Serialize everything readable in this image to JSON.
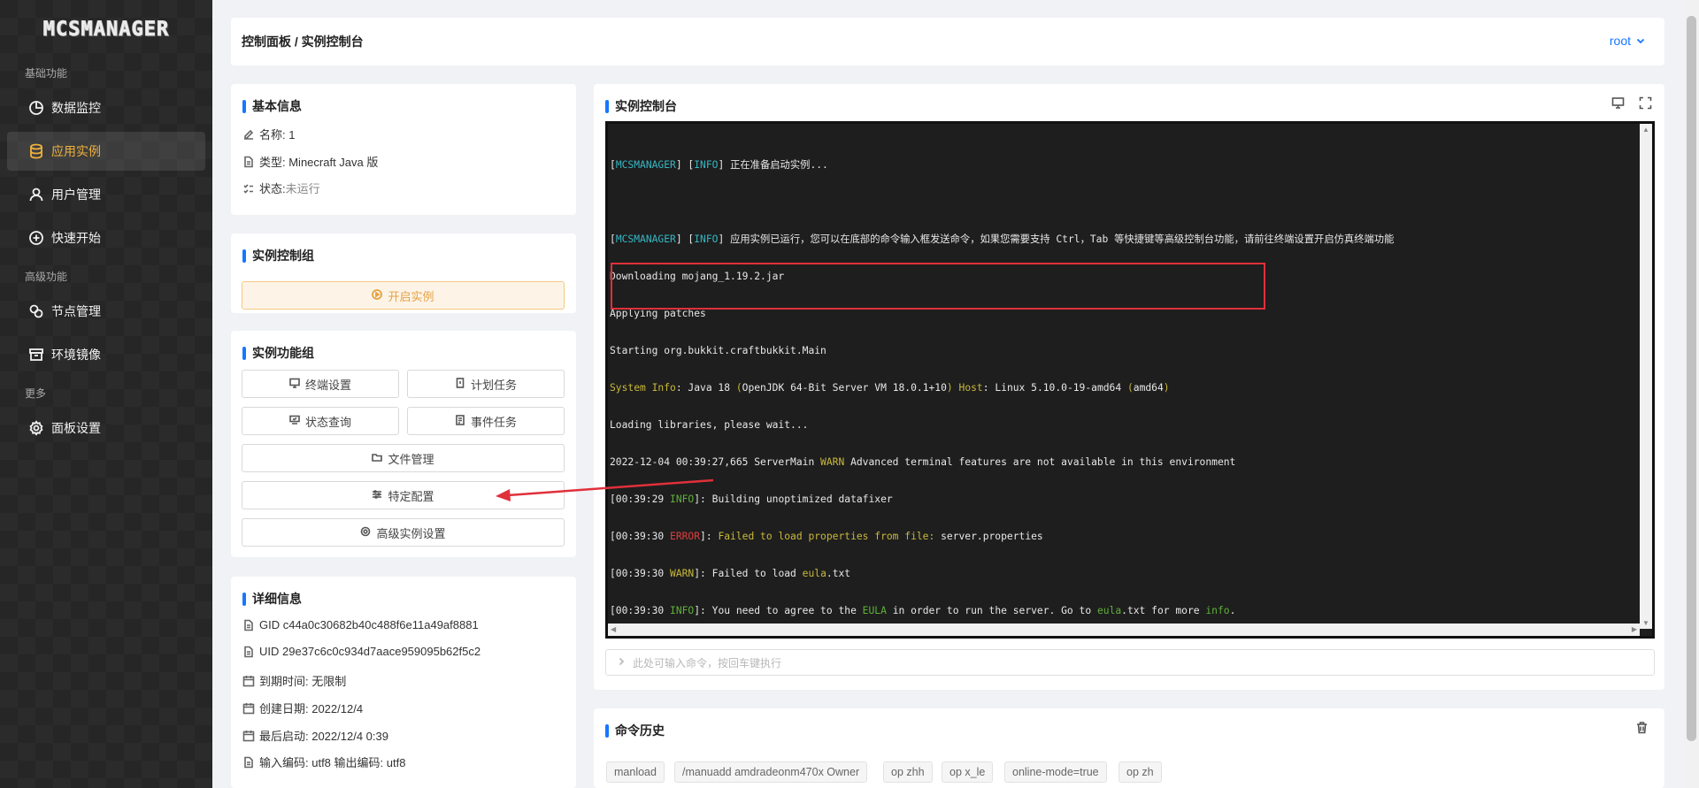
{
  "app": {
    "logo_text": "MCSMANAGER"
  },
  "sidebar": {
    "groups": [
      {
        "title": "基础功能"
      },
      {
        "title": "高级功能"
      },
      {
        "title": "更多"
      }
    ],
    "items": [
      {
        "label": "数据监控",
        "icon": "pie-chart-icon"
      },
      {
        "label": "应用实例",
        "icon": "database-icon",
        "active": true
      },
      {
        "label": "用户管理",
        "icon": "user-icon"
      },
      {
        "label": "快速开始",
        "icon": "plus-circle-icon"
      },
      {
        "label": "节点管理",
        "icon": "nodes-icon"
      },
      {
        "label": "环境镜像",
        "icon": "image-box-icon"
      },
      {
        "label": "面板设置",
        "icon": "gear-icon"
      }
    ]
  },
  "header": {
    "breadcrumb": "控制面板 / 实例控制台",
    "user": "root"
  },
  "basic_info": {
    "title": "基本信息",
    "name": "名称: 1",
    "type": "类型: Minecraft Java 版",
    "status_label": "状态: ",
    "status_value": "未运行"
  },
  "control_group": {
    "title": "实例控制组",
    "start_label": "开启实例"
  },
  "function_group": {
    "title": "实例功能组",
    "buttons": {
      "terminal": "终端设置",
      "schedule": "计划任务",
      "status": "状态查询",
      "events": "事件任务",
      "files": "文件管理",
      "config": "特定配置",
      "advanced": "高级实例设置"
    }
  },
  "details": {
    "title": "详细信息",
    "gid": "GID c44a0c30682b40c488f6e11a49af8881",
    "uid": "UID 29e37c6c0c934d7aace959095b62f5c2",
    "expire": "到期时间: 无限制",
    "created": "创建日期: 2022/12/4",
    "last_start": "最后启动: 2022/12/4 0:39",
    "encoding": "输入编码: utf8 输出编码: utf8"
  },
  "console": {
    "title": "实例控制台",
    "input_placeholder": "此处可输入命令，按回车键执行",
    "lines": {
      "l1_tag": "MCSMANAGER",
      "l1_level": "INFO",
      "l1_msg": " 正在准备启动实例...",
      "l2_tag": "MCSMANAGER",
      "l2_level": "INFO",
      "l2_msg": " 应用实例已运行，您可以在底部的命令输入框发送命令，如果您需要支持 Ctrl，Tab 等快捷键等高级控制台功能，请前往终端设置开启仿真终端功能",
      "l3": "Downloading mojang_1.19.2.jar",
      "l4": "Applying patches",
      "l5": "Starting org.bukkit.craftbukkit.Main",
      "l6_a": "System Info",
      "l6_b": ": Java 18 ",
      "l6_c": "(",
      "l6_d": "OpenJDK 64-Bit Server VM 18.0.1+10",
      "l6_e": ") ",
      "l6_f": "Host",
      "l6_g": ": Linux 5.10.0-19-amd64 ",
      "l6_h": "(",
      "l6_i": "amd64",
      "l6_j": ")",
      "l7": "Loading libraries, please wait...",
      "l8_a": "2022-12-04 00:39:27,665 ServerMain ",
      "l8_b": "WARN",
      "l8_c": " Advanced terminal features are not available in this environment",
      "l9_a": "[00:39:29 ",
      "l9_b": "INFO",
      "l9_c": "]: Building unoptimized datafixer",
      "l10_a": "[00:39:30 ",
      "l10_b": "ERROR",
      "l10_c": "]: ",
      "l10_d": "Failed to load properties from file:",
      "l10_e": " server.properties",
      "l11_a": "[00:39:30 ",
      "l11_b": "WARN",
      "l11_c": "]: Failed to load ",
      "l11_d": "eula",
      "l11_e": ".txt",
      "l12_a": "[00:39:30 ",
      "l12_b": "INFO",
      "l12_c": "]: You need to agree to the ",
      "l12_d": "EULA",
      "l12_e": " in order to run the server. Go to ",
      "l12_f": "eula",
      "l12_g": ".txt for more ",
      "l12_h": "info",
      "l12_i": "."
    }
  },
  "history": {
    "title": "命令历史",
    "tags": [
      "manload",
      "/manuadd amdradeonm470x Owner",
      "op zhh",
      "op x_le",
      "online-mode=true",
      "op zh"
    ]
  },
  "colors": {
    "accent": "#1677ff",
    "active_menu": "#f0b13c",
    "annotation_red": "#e0303a",
    "start_button_text": "#e5a142"
  }
}
